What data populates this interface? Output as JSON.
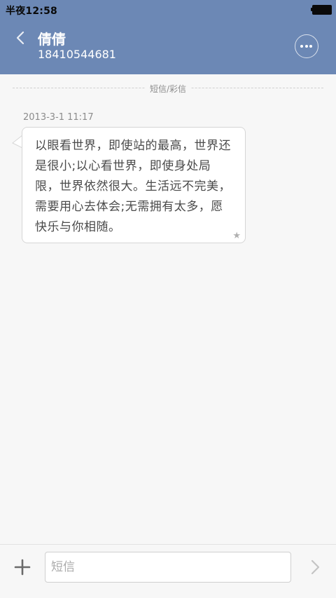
{
  "status_bar": {
    "time": "半夜12:58"
  },
  "header": {
    "contact_name": "倩倩",
    "contact_number": "18410544681"
  },
  "conversation": {
    "divider_label": "短信/彩信",
    "messages": [
      {
        "timestamp": "2013-3-1 11:17",
        "text": "以眼看世界，即使站的最高，世界还是很小;以心看世界，即使身处局限，世界依然很大。生活远不完美，需要用心去体会;无需拥有太多，愿快乐与你相随。"
      }
    ]
  },
  "compose": {
    "placeholder": "短信"
  },
  "colors": {
    "header_bg": "#6c88b5",
    "page_bg": "#f7f7f7",
    "bubble_bg": "#ffffff",
    "bubble_border": "#d6d6d6",
    "text_gray": "#4a4a4a"
  },
  "icons": {
    "back": "chevron-left-icon",
    "more": "more-dots-icon",
    "star": "star-icon",
    "add": "plus-icon",
    "send": "chevron-right-icon",
    "battery": "battery-icon"
  }
}
